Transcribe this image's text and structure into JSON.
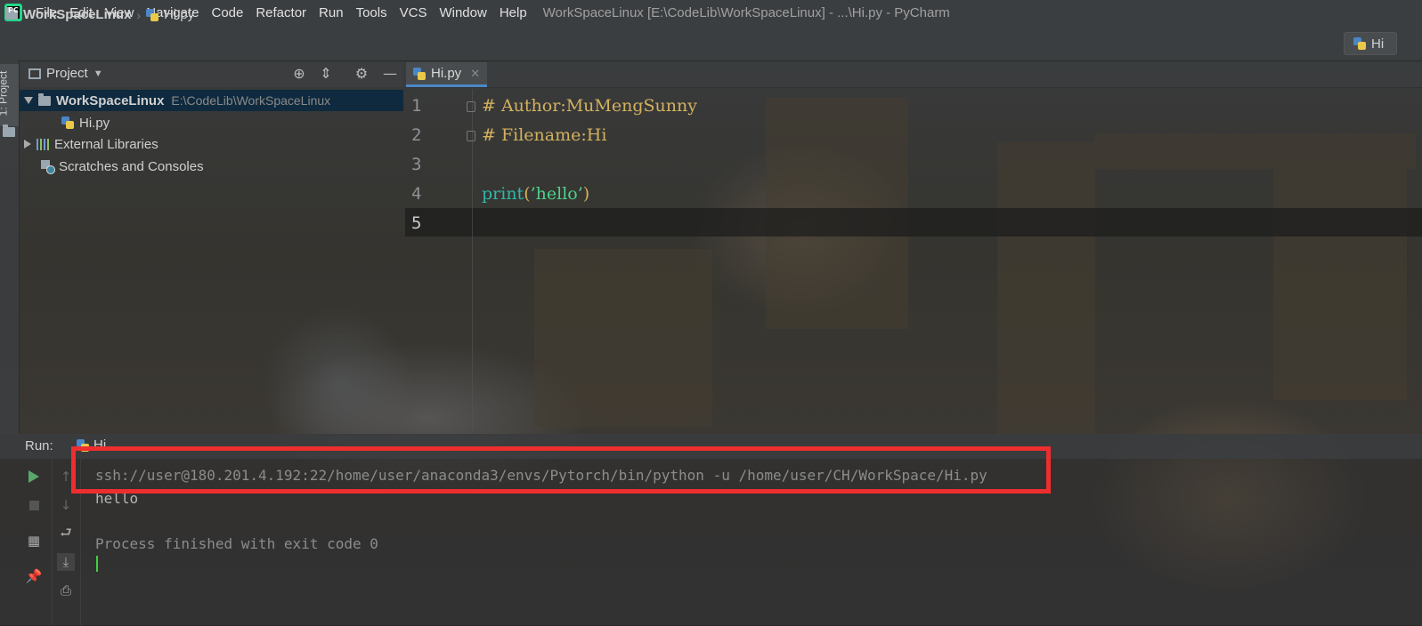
{
  "menubar": {
    "logo_text": "PC",
    "items": [
      "File",
      "Edit",
      "View",
      "Navigate",
      "Code",
      "Refactor",
      "Run",
      "Tools",
      "VCS",
      "Window",
      "Help"
    ],
    "window_title": "WorkSpaceLinux [E:\\CodeLib\\WorkSpaceLinux] - ...\\Hi.py - PyCharm"
  },
  "navbar": {
    "project": "WorkSpaceLinux",
    "file": "Hi.py",
    "run_config": "Hi"
  },
  "tool_strip": {
    "project_tab": "1: Project"
  },
  "project_panel": {
    "title": "Project",
    "tree": {
      "root_name": "WorkSpaceLinux",
      "root_path": "E:\\CodeLib\\WorkSpaceLinux",
      "file": "Hi.py",
      "external_libraries": "External Libraries",
      "scratches": "Scratches and Consoles"
    }
  },
  "editor": {
    "tab_label": "Hi.py",
    "line_numbers": [
      "1",
      "2",
      "3",
      "4",
      "5"
    ],
    "lines": {
      "l1": "# Author:MuMengSunny",
      "l2": "# Filename:Hi",
      "l4_func": "print",
      "l4_open": "(",
      "l4_str": "’hello’",
      "l4_close": ")"
    }
  },
  "run_panel": {
    "label": "Run:",
    "tab": "Hi",
    "console": {
      "command": "ssh://user@180.201.4.192:22/home/user/anaconda3/envs/Pytorch/bin/python -u /home/user/CH/WorkSpace/Hi.py",
      "output": "hello",
      "exit": "Process finished with exit code 0"
    }
  },
  "colors": {
    "highlight_box": "#ee2e2e",
    "comment": "#d3b15f",
    "keyword": "#2fb7a8",
    "string": "#4fd08d",
    "run_green": "#59a869",
    "selection": "#0d293e"
  }
}
